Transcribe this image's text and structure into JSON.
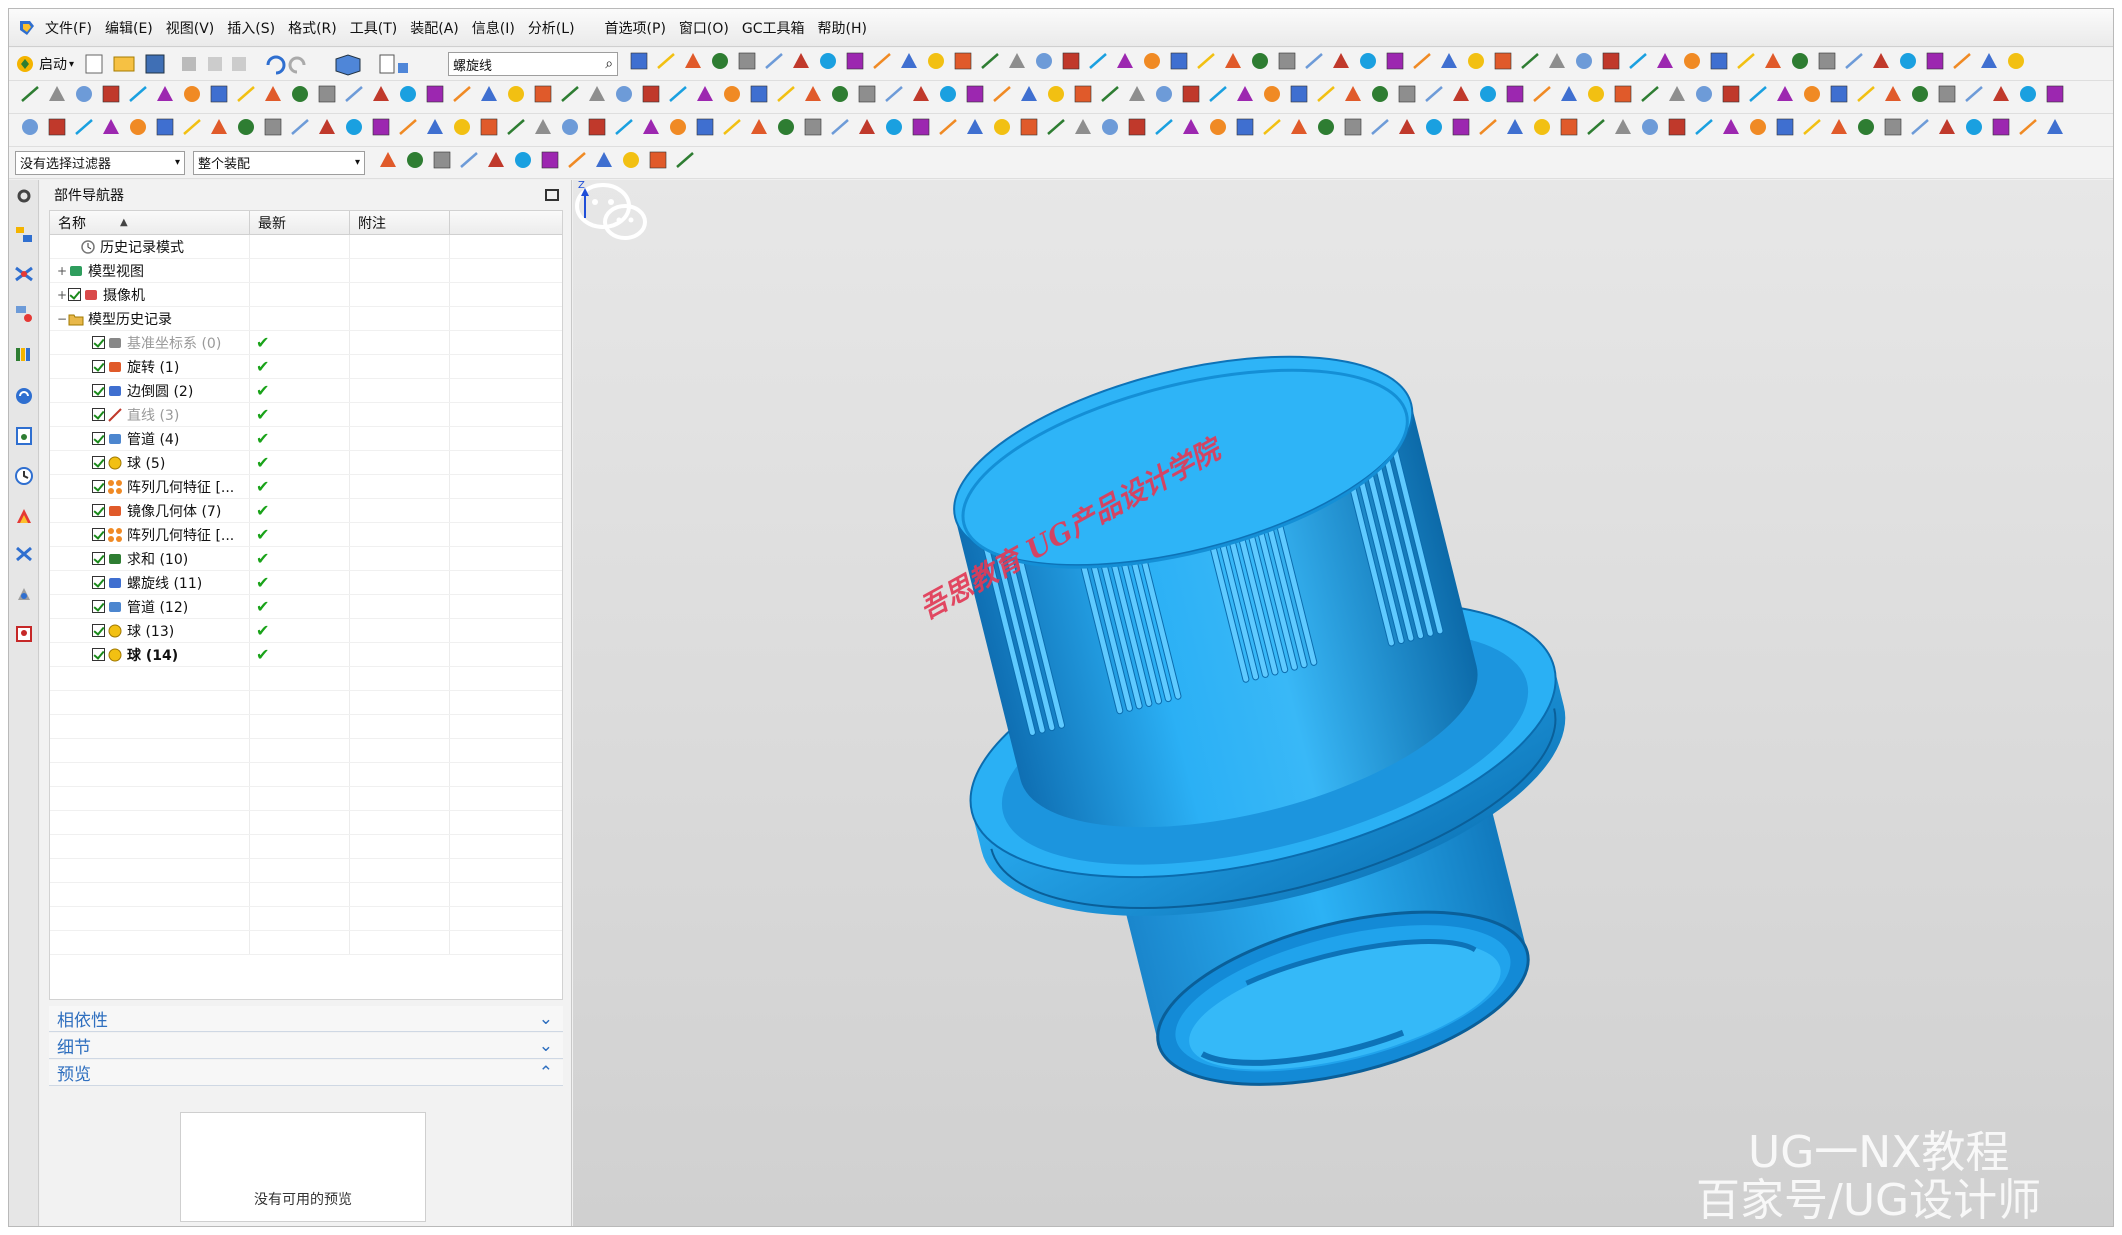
{
  "menubar": {
    "items": [
      "文件(F)",
      "编辑(E)",
      "视图(V)",
      "插入(S)",
      "格式(R)",
      "工具(T)",
      "装配(A)",
      "信息(I)",
      "分析(L)",
      "首选项(P)",
      "窗口(O)",
      "GC工具箱",
      "帮助(H)"
    ]
  },
  "toolbar": {
    "start_label": "启动",
    "command_search_value": "螺旋线",
    "selection_filter": "没有选择过滤器",
    "assembly_scope": "整个装配"
  },
  "navigator": {
    "title": "部件导航器",
    "columns": {
      "name": "名称",
      "latest": "最新",
      "note": "附注"
    },
    "rows": [
      {
        "label": "历史记录模式",
        "indent": 1,
        "expander": "",
        "check": false,
        "latest": "",
        "style": "",
        "icon": "history-icon"
      },
      {
        "label": "模型视图",
        "indent": 0,
        "expander": "+",
        "check": false,
        "latest": "",
        "style": "",
        "icon": "model-views-icon"
      },
      {
        "label": "摄像机",
        "indent": 0,
        "expander": "+",
        "check": true,
        "latest": "",
        "style": "",
        "icon": "camera-icon"
      },
      {
        "label": "模型历史记录",
        "indent": 0,
        "expander": "−",
        "check": false,
        "latest": "",
        "style": "",
        "icon": "folder-icon"
      },
      {
        "label": "基准坐标系 (0)",
        "indent": 2,
        "expander": "",
        "check": true,
        "latest": "✔",
        "style": "grey",
        "icon": "datum-csys-icon"
      },
      {
        "label": "旋转 (1)",
        "indent": 2,
        "expander": "",
        "check": true,
        "latest": "✔",
        "style": "",
        "icon": "revolve-icon"
      },
      {
        "label": "边倒圆 (2)",
        "indent": 2,
        "expander": "",
        "check": true,
        "latest": "✔",
        "style": "",
        "icon": "edge-blend-icon"
      },
      {
        "label": "直线 (3)",
        "indent": 2,
        "expander": "",
        "check": true,
        "latest": "✔",
        "style": "grey",
        "icon": "line-icon"
      },
      {
        "label": "管道 (4)",
        "indent": 2,
        "expander": "",
        "check": true,
        "latest": "✔",
        "style": "",
        "icon": "tube-icon"
      },
      {
        "label": "球 (5)",
        "indent": 2,
        "expander": "",
        "check": true,
        "latest": "✔",
        "style": "",
        "icon": "sphere-icon"
      },
      {
        "label": "阵列几何特征 [...",
        "indent": 2,
        "expander": "",
        "check": true,
        "latest": "✔",
        "style": "",
        "icon": "pattern-icon"
      },
      {
        "label": "镜像几何体 (7)",
        "indent": 2,
        "expander": "",
        "check": true,
        "latest": "✔",
        "style": "",
        "icon": "mirror-icon"
      },
      {
        "label": "阵列几何特征 [...",
        "indent": 2,
        "expander": "",
        "check": true,
        "latest": "✔",
        "style": "",
        "icon": "pattern-icon"
      },
      {
        "label": "求和 (10)",
        "indent": 2,
        "expander": "",
        "check": true,
        "latest": "✔",
        "style": "",
        "icon": "unite-icon"
      },
      {
        "label": "螺旋线 (11)",
        "indent": 2,
        "expander": "",
        "check": true,
        "latest": "✔",
        "style": "",
        "icon": "helix-icon"
      },
      {
        "label": "管道 (12)",
        "indent": 2,
        "expander": "",
        "check": true,
        "latest": "✔",
        "style": "",
        "icon": "tube-icon"
      },
      {
        "label": "球 (13)",
        "indent": 2,
        "expander": "",
        "check": true,
        "latest": "✔",
        "style": "",
        "icon": "sphere-icon"
      },
      {
        "label": "球 (14)",
        "indent": 2,
        "expander": "",
        "check": true,
        "latest": "✔",
        "style": "bold",
        "icon": "sphere-icon"
      }
    ],
    "panels": {
      "dependencies": "相依性",
      "details": "细节",
      "preview": "预览"
    },
    "preview_empty_text": "没有可用的预览"
  },
  "viewport": {
    "model_color": "#1e9ee8",
    "red_watermark": "吾思教育 UG产品设计学院",
    "watermark_line1": "UG一NX教程",
    "watermark_line2": "百家号/UG设计师",
    "triad_axis_label": "Z"
  }
}
